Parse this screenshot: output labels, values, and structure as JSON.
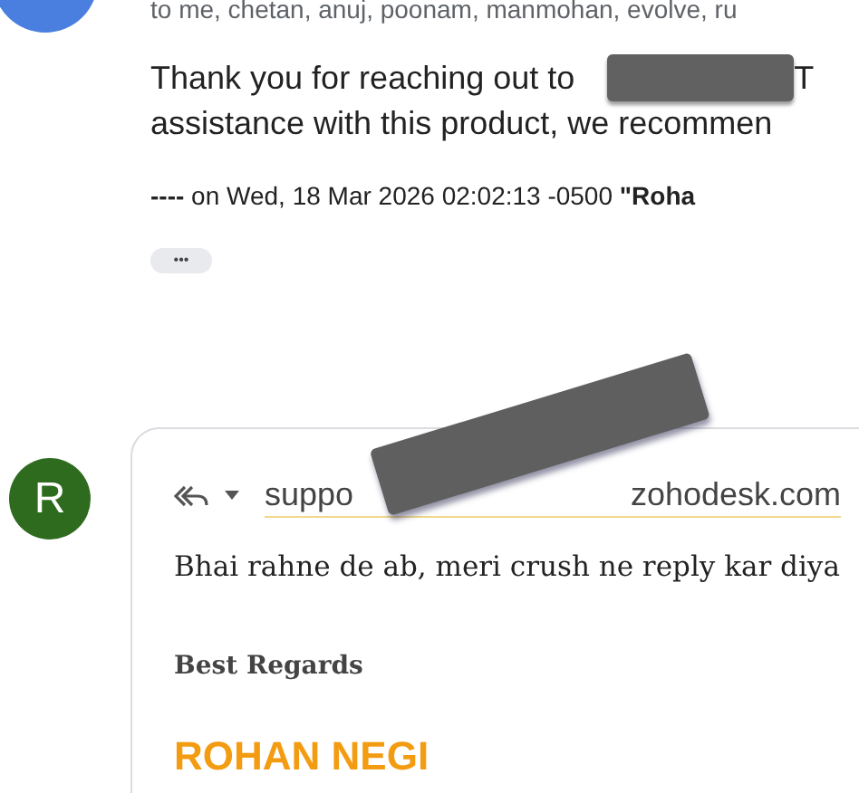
{
  "previous_message": {
    "recipients": "to me, chetan, anuj, poonam, manmohan, evolve, ru",
    "body_lines": [
      {
        "before": "Thank you for reaching out to",
        "redacted": true,
        "after": "T"
      },
      {
        "before": "assistance with this product, we recommen",
        "redacted": false
      }
    ],
    "quote_header": "**----** on Wed, 18 Mar 2026 02:02:13 -0500 **\"Roha**",
    "expand_button": "•••"
  },
  "reply": {
    "avatar_letter": "R",
    "to_start": "suppo",
    "to_end": "zohodesk.com",
    "to_redacted": true,
    "body": "Bhai rahne de ab, meri crush ne reply kar diya",
    "closing": "Best Regards",
    "signature_name": "ROHAN NEGI"
  }
}
